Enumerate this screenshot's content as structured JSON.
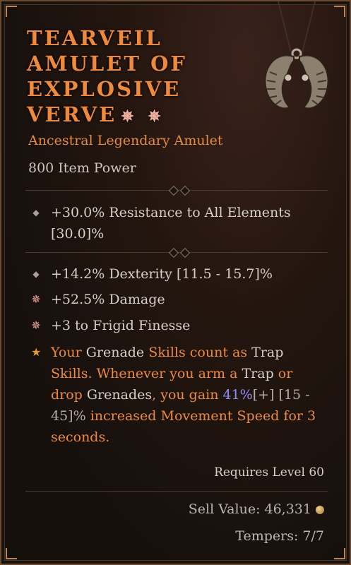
{
  "item": {
    "title_lines": [
      "Tearveil",
      "Amulet of",
      "Explosive",
      "Verve"
    ],
    "socket_icon": "burst-socket-icon",
    "subtitle": "Ancestral Legendary Amulet",
    "power": "800 Item Power"
  },
  "implicit": {
    "text": "+30.0% Resistance to All Elements",
    "range": "[30.0]%"
  },
  "affixes": [
    {
      "icon": "diamond-icon",
      "text": "+14.2% Dexterity [11.5 - 15.7]%"
    },
    {
      "icon": "greater-affix-icon",
      "text": "+52.5% Damage"
    },
    {
      "icon": "greater-affix-icon",
      "text": "+3 to Frigid Finesse"
    }
  ],
  "legendary": {
    "icon": "legendary-star-icon",
    "lines": [
      [
        "Your ",
        "Grenade",
        " Skills count as ",
        "Trap"
      ],
      [
        "Skills.",
        " Whenever you arm a ",
        "Trap",
        " or"
      ],
      [
        "drop ",
        "Grenades",
        ", you gain ",
        "41%",
        "[+]",
        " [15 -"
      ],
      [
        "45]%",
        " increased Movement Speed for 3"
      ],
      [
        "seconds."
      ]
    ]
  },
  "requirements": "Requires Level 60",
  "sell_value": "Sell Value: 46,331",
  "tempers": "Tempers: 7/7",
  "colors": {
    "legendary_orange": "#ef8a3c",
    "stat_text": "#d6d0c8",
    "roll_blue": "#8f8cf5",
    "greater_affix": "#f1a8a0"
  }
}
